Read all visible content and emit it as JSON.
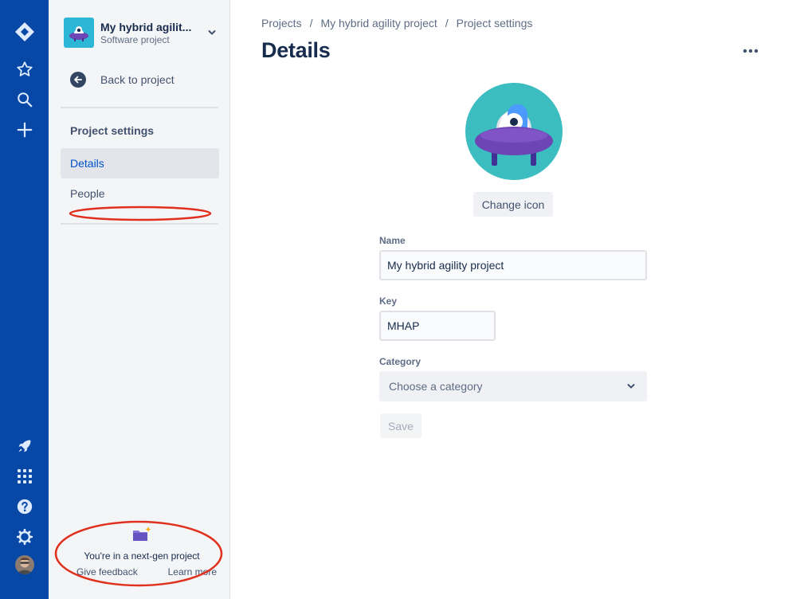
{
  "colors": {
    "global_nav": "#0747a6",
    "sidebar_bg": "#f4f5f7",
    "active_item_text": "#0052cc",
    "annotation_red": "#e0301e",
    "project_avatar_bg": "#2bb7d5"
  },
  "global_nav": {
    "items": [
      {
        "icon": "jira-logo-icon"
      },
      {
        "icon": "star-icon"
      },
      {
        "icon": "search-icon"
      },
      {
        "icon": "plus-icon"
      },
      {
        "icon": "rocket-icon"
      },
      {
        "icon": "app-switcher-icon"
      },
      {
        "icon": "help-icon"
      },
      {
        "icon": "gear-icon"
      },
      {
        "icon": "user-avatar"
      }
    ]
  },
  "sidebar": {
    "project_name": "My hybrid agilit...",
    "project_type": "Software project",
    "back_label": "Back to project",
    "section_title": "Project settings",
    "items": [
      {
        "label": "Details",
        "active": true
      },
      {
        "label": "People",
        "active": false
      }
    ],
    "footer": {
      "text": "You're in a next-gen project",
      "give_feedback": "Give feedback",
      "learn_more": "Learn more"
    }
  },
  "breadcrumbs": [
    "Projects",
    "My hybrid agility project",
    "Project settings"
  ],
  "page": {
    "title": "Details",
    "change_icon_label": "Change icon",
    "fields": {
      "name_label": "Name",
      "name_value": "My hybrid agility project",
      "key_label": "Key",
      "key_value": "MHAP",
      "category_label": "Category",
      "category_placeholder": "Choose a category"
    },
    "save_label": "Save"
  }
}
